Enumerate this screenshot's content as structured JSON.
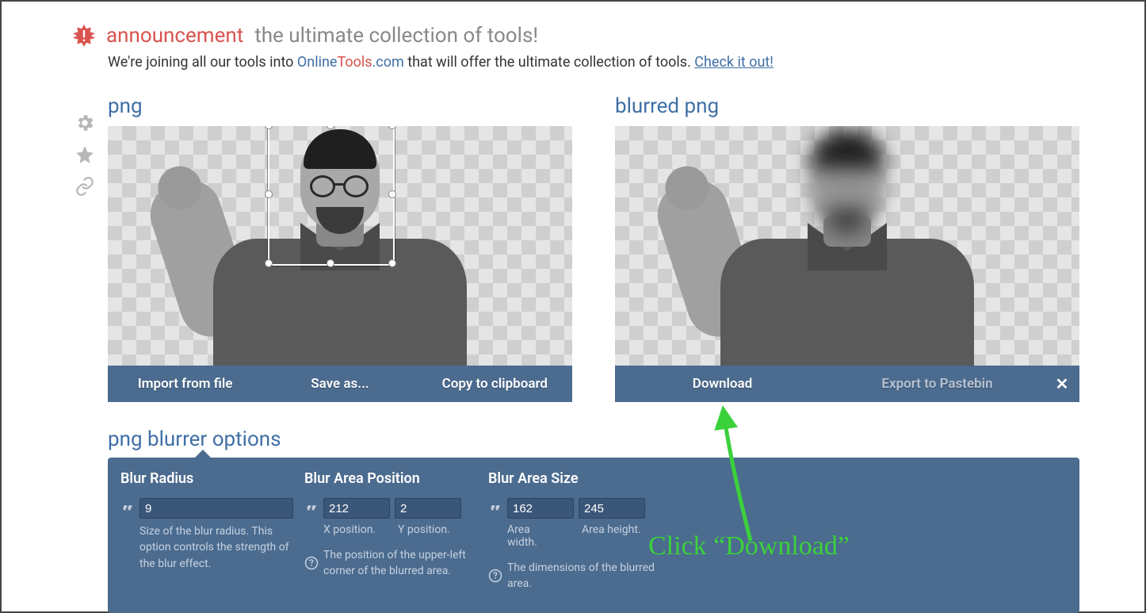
{
  "announcement": {
    "title": "announcement",
    "subtitle": "the ultimate collection of tools!",
    "body_pre": "We're joining all our tools into ",
    "brand_online": "Online",
    "brand_tools": "Tools",
    "brand_dotcom": ".com",
    "body_mid": " that will offer the ultimate collection of tools. ",
    "check_link": "Check it out!"
  },
  "panels": {
    "left_title": "png",
    "right_title": "blurred png",
    "left_actions": {
      "import": "Import from file",
      "save": "Save as...",
      "copy": "Copy to clipboard"
    },
    "right_actions": {
      "download": "Download",
      "export": "Export to Pastebin"
    }
  },
  "options_title": "png blurrer options",
  "options": {
    "radius": {
      "heading": "Blur Radius",
      "value": "9",
      "desc": "Size of the blur radius. This option controls the strength of the blur effect."
    },
    "position": {
      "heading": "Blur Area Position",
      "x": "212",
      "y": "2",
      "xlabel": "X position.",
      "ylabel": "Y position.",
      "desc": "The position of the upper-left corner of the blurred area."
    },
    "size": {
      "heading": "Blur Area Size",
      "w": "162",
      "h": "245",
      "wlabel": "Area width.",
      "hlabel": "Area height.",
      "desc": "The dimensions of the blurred area."
    }
  },
  "hint": "Click  “Download”"
}
